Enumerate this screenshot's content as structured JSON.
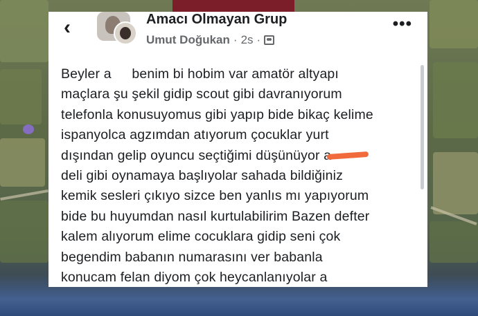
{
  "header": {
    "back_icon": "chevron-left-icon",
    "group_name": "Amacı Olmayan Grup",
    "author": "Umut Doğukan",
    "separator": "·",
    "time": "2s",
    "privacy_icon": "group-icon",
    "more_label": "•••"
  },
  "post": {
    "lines": [
      "Beyler a",
      "benim bi hobim var amatör altyapı",
      "maçlara şu şekil gidip scout gibi davranıyorum",
      "telefonla konusuyomus gibi yapıp bide bikaç kelime",
      "ispanyolca agzımdan atıyorum çocuklar yurt",
      "dışından gelip oyuncu seçtiğimi düşünüyor a",
      "deli gibi oynamaya başlıyolar sahada bildiğiniz",
      "kemik sesleri çıkıyo sizce ben yanlıs mı yapıyorum",
      "bide bu huyumdan nasıl kurtulabilirim Bazen defter",
      "kalem alıyorum elime cocuklara gidip seni çok",
      "begendim babanın numarasını ver babanla",
      "konucam felan diyom çok heycanlanıyolar a"
    ]
  },
  "colors": {
    "redaction": "#f06a3c",
    "text": "#1c1e21",
    "meta": "#65676b"
  }
}
